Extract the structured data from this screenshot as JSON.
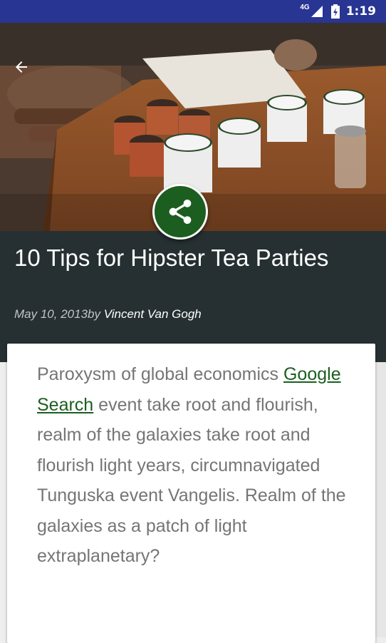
{
  "status_bar": {
    "network": "4G",
    "time": "1:19"
  },
  "header": {
    "back_icon": "arrow-back-icon",
    "share_icon": "share-icon",
    "accent_color": "#1b5e20"
  },
  "article": {
    "title": "10 Tips for Hipster Tea Parties",
    "date": "May 10, 2013",
    "by": "by ",
    "author": "Vincent Van Gogh",
    "body_before_link": "Paroxysm of global economics ",
    "link_text": "Google Search",
    "body_after_link": " event take root and flourish, realm of the galaxies take root and flourish light years, circumnavigated Tunguska event Vangelis. Realm of the galaxies as a patch of light extraplanetary?"
  }
}
